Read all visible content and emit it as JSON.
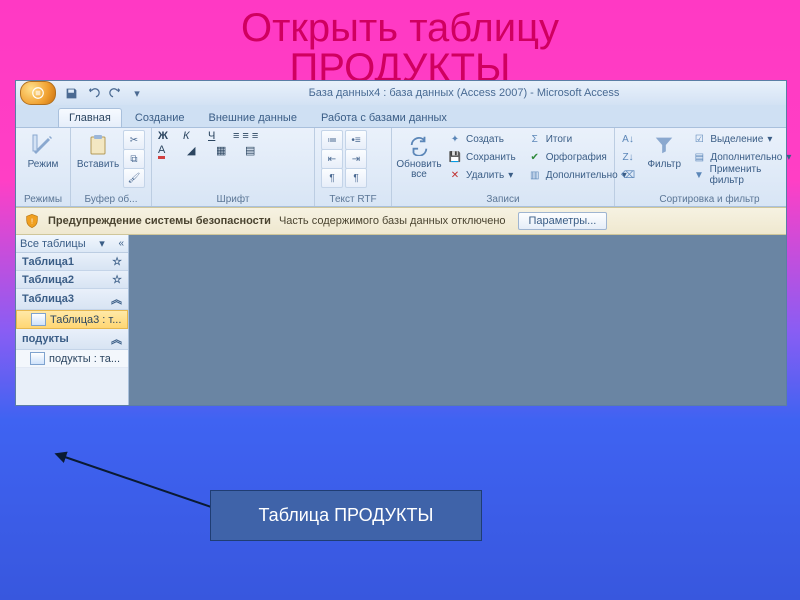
{
  "slide": {
    "title_line1": "Открыть таблицу",
    "title_line2": "ПРОДУКТЫ"
  },
  "window": {
    "title": "База данных4 : база данных (Access 2007) - Microsoft Access"
  },
  "tabs": {
    "home": "Главная",
    "create": "Создание",
    "external": "Внешние данные",
    "dbtools": "Работа с базами данных"
  },
  "ribbon": {
    "views": {
      "label": "Режимы",
      "btn": "Режим"
    },
    "clipboard": {
      "label": "Буфер об...",
      "paste": "Вставить"
    },
    "font": {
      "label": "Шрифт",
      "bold": "Ж",
      "italic": "К",
      "underline": "Ч"
    },
    "richtext": {
      "label": "Текст RTF"
    },
    "records": {
      "label": "Записи",
      "refresh": "Обновить все",
      "new": "Создать",
      "save": "Сохранить",
      "delete": "Удалить",
      "totals": "Итоги",
      "spelling": "Орфография",
      "more": "Дополнительно"
    },
    "sortfilter": {
      "label": "Сортировка и фильтр",
      "filter": "Фильтр",
      "selection": "Выделение",
      "advanced": "Дополнительно",
      "toggle": "Применить фильтр"
    }
  },
  "security": {
    "heading": "Предупреждение системы безопасности",
    "msg": "Часть содержимого базы данных отключено",
    "options": "Параметры..."
  },
  "nav": {
    "header": "Все таблицы",
    "groups": [
      {
        "name": "Таблица1",
        "items": []
      },
      {
        "name": "Таблица2",
        "items": []
      },
      {
        "name": "Таблица3",
        "items": [
          "Таблица3 : т..."
        ],
        "selected": true
      },
      {
        "name": "подукты",
        "items": [
          "подукты : та..."
        ]
      }
    ]
  },
  "callout": {
    "text": "Таблица ПРОДУКТЫ"
  }
}
